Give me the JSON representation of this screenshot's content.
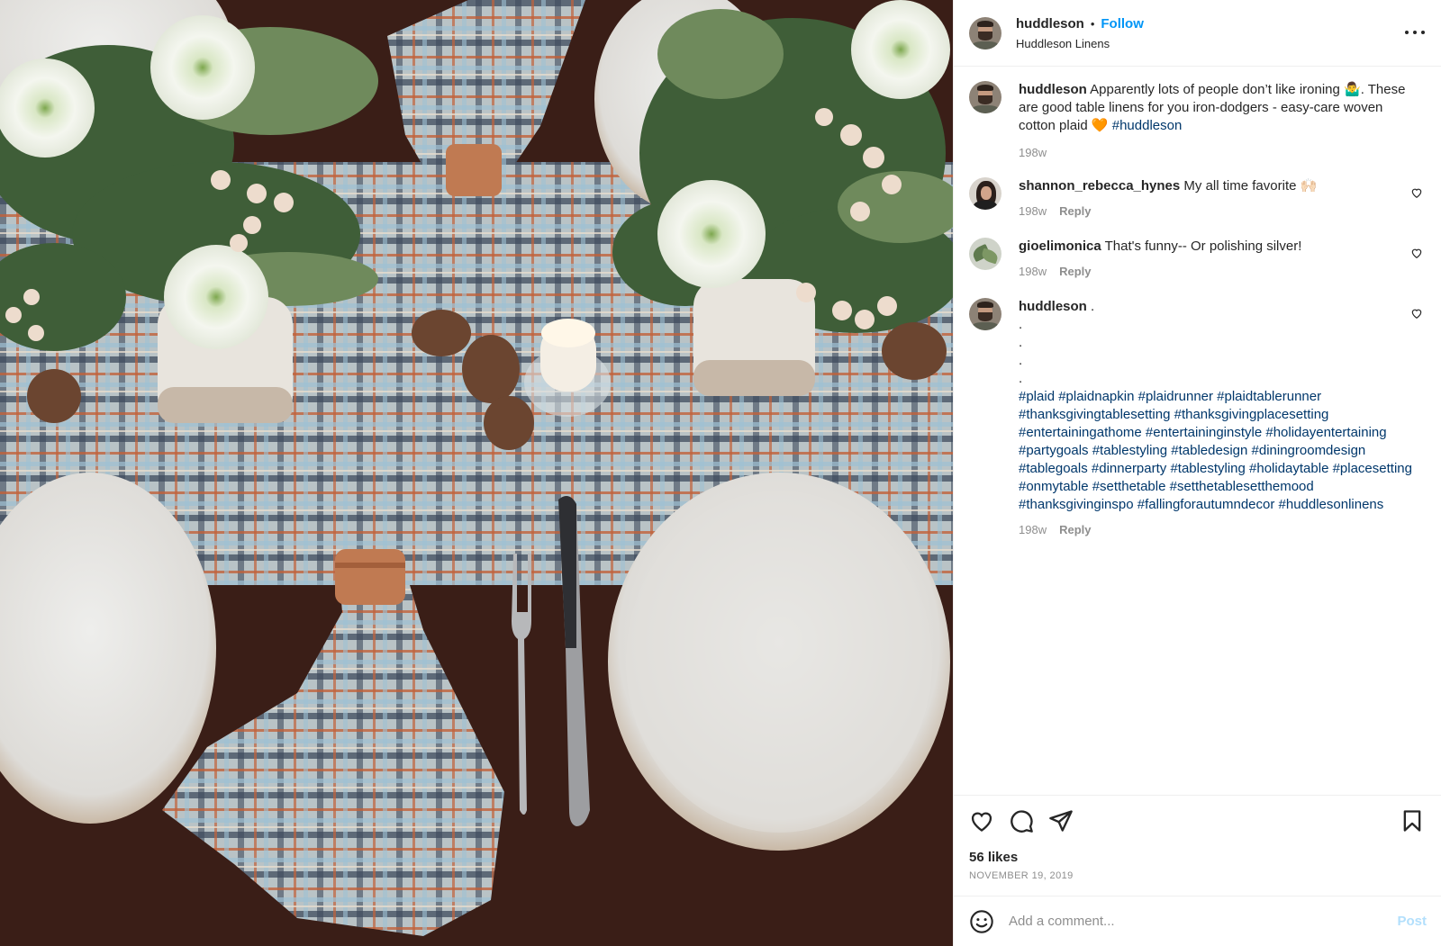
{
  "post": {
    "author": "huddleson",
    "separator": "•",
    "follow_label": "Follow",
    "subtitle": "Huddleson Linens",
    "more_icon": "more-options-icon"
  },
  "caption": {
    "username": "huddleson",
    "text": "Apparently lots of people don’t like ironing 🤷‍♂️. These are good table linens for you iron-dodgers - easy-care woven cotton plaid 🧡 ",
    "hashtag": "#huddleson",
    "time": "198w"
  },
  "comments": [
    {
      "username": "shannon_rebecca_hynes",
      "text": "My all time favorite 🙌🏻",
      "time": "198w",
      "reply": "Reply"
    },
    {
      "username": "gioelimonica",
      "text": "That's funny-- Or polishing silver!",
      "time": "198w",
      "reply": "Reply"
    },
    {
      "username": "huddleson",
      "text": ".",
      "dots": [
        ".",
        ".",
        ".",
        "."
      ],
      "hashtags": "#plaid #plaidnapkin #plaidrunner #plaidtablerunner #thanksgivingtablesetting #thanksgivingplacesetting #entertainingathome #entertaininginstyle #holidayentertaining #partygoals #tablestyling #tabledesign #diningroomdesign #tablegoals #dinnerparty #tablestyling #holidaytable #placesetting #onmytable #setthetable #setthetablesetthemood #thanksgivinginspo #fallingforautumndecor #huddlesonlinens",
      "time": "198w",
      "reply": "Reply"
    }
  ],
  "actions": {
    "icons": [
      "heart-icon",
      "comment-icon",
      "share-icon",
      "bookmark-icon"
    ],
    "likes": "56 likes",
    "date": "NOVEMBER 19, 2019"
  },
  "add_comment": {
    "placeholder": "Add a comment...",
    "post_label": "Post",
    "emoji_icon": "emoji-icon"
  },
  "colors": {
    "link": "#0095f6",
    "hashtag": "#00376b",
    "muted": "#8e8e8e",
    "table": "#3a1e17"
  }
}
